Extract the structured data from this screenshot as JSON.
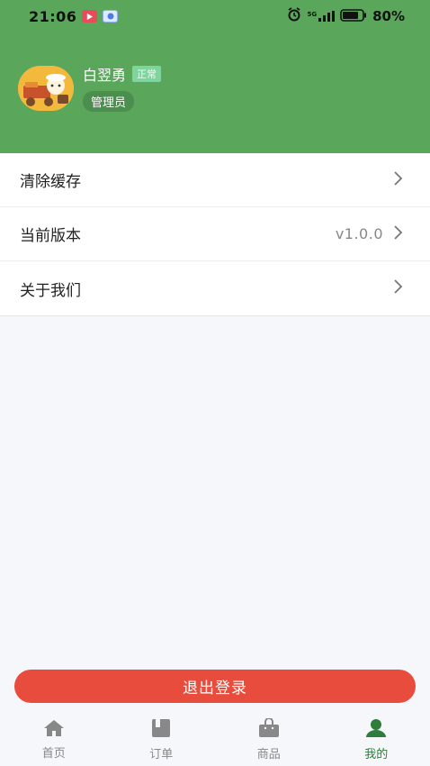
{
  "status_bar": {
    "time": "21:06",
    "battery": "80%",
    "network": "5G"
  },
  "profile": {
    "name": "白翌勇",
    "status": "正常",
    "role": "管理员"
  },
  "menu": {
    "items": [
      {
        "label": "清除缓存",
        "value": ""
      },
      {
        "label": "当前版本",
        "value": "v1.0.0"
      },
      {
        "label": "关于我们",
        "value": ""
      }
    ]
  },
  "logout_label": "退出登录",
  "tabbar": {
    "tabs": [
      {
        "label": "首页",
        "icon": "home-icon",
        "active": false
      },
      {
        "label": "订单",
        "icon": "order-icon",
        "active": false
      },
      {
        "label": "商品",
        "icon": "bag-icon",
        "active": false
      },
      {
        "label": "我的",
        "icon": "user-icon",
        "active": true
      }
    ]
  },
  "colors": {
    "header_green": "#5aa75b",
    "logout_red": "#e84c3d",
    "active_tab": "#2e7d3a"
  }
}
